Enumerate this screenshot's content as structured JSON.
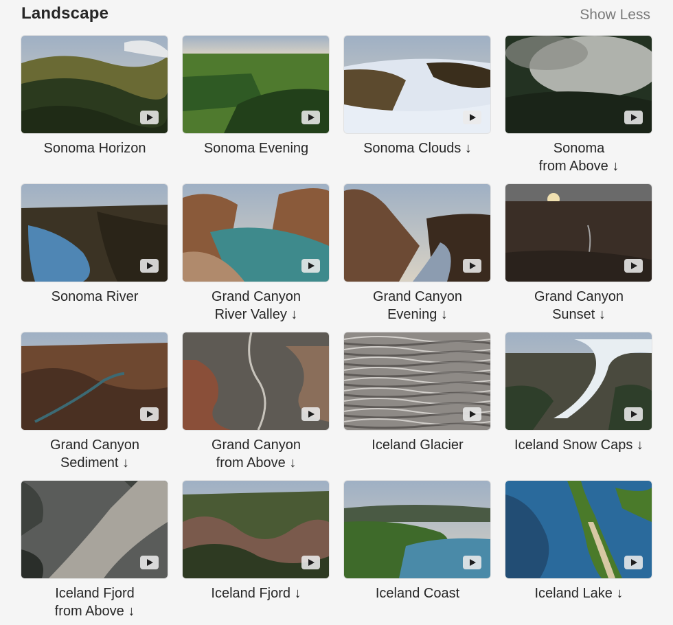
{
  "section": {
    "title": "Landscape",
    "toggle_label": "Show Less"
  },
  "tiles": [
    {
      "line1": "Sonoma Horizon",
      "line2": "",
      "scene": "hills",
      "colors": [
        "#9fb0c4",
        "#d9d2c4",
        "#2b3a1e",
        "#6a6a34",
        "#1f2b16"
      ]
    },
    {
      "line1": "Sonoma Evening",
      "line2": "",
      "scene": "fields",
      "colors": [
        "#9aa5b4",
        "#e5c9a0",
        "#2f5a24",
        "#4f7a2e",
        "#22401a"
      ]
    },
    {
      "line1": "Sonoma Clouds ↓",
      "line2": "",
      "scene": "fog",
      "colors": [
        "#7fa0c8",
        "#e8d8c0",
        "#5c4a2e",
        "#dfe6f0",
        "#3a2e1c"
      ]
    },
    {
      "line1": "Sonoma",
      "line2": "from Above ↓",
      "scene": "forest",
      "colors": [
        "#8a8c86",
        "#c8c9c4",
        "#233222",
        "#3d4a32",
        "#1a2418"
      ]
    },
    {
      "line1": "Sonoma River",
      "line2": "",
      "scene": "river",
      "colors": [
        "#b8c4cc",
        "#e8dcc4",
        "#3b3324",
        "#4f86b4",
        "#2a2418"
      ]
    },
    {
      "line1": "Grand Canyon",
      "line2": "River Valley ↓",
      "scene": "canyon-river",
      "colors": [
        "#c8d4e0",
        "#e6e6e6",
        "#8a5a3a",
        "#3e8a8c",
        "#b08a6c"
      ]
    },
    {
      "line1": "Grand Canyon",
      "line2": "Evening ↓",
      "scene": "canyon-evening",
      "colors": [
        "#5a84bc",
        "#a8c4e0",
        "#6c4a34",
        "#8c9cb0",
        "#3a2a1e"
      ]
    },
    {
      "line1": "Grand Canyon",
      "line2": "Sunset ↓",
      "scene": "sunset",
      "colors": [
        "#6a6a6a",
        "#f0e0b0",
        "#3a2e26",
        "#a4a4a4",
        "#2a221c"
      ]
    },
    {
      "line1": "Grand Canyon",
      "line2": "Sediment ↓",
      "scene": "canyon-sediment",
      "colors": [
        "#9cb0c8",
        "#d8c4a4",
        "#6e4830",
        "#3c6a74",
        "#4a3022"
      ]
    },
    {
      "line1": "Grand Canyon",
      "line2": "from Above ↓",
      "scene": "aerial",
      "colors": [
        "#5e5a54",
        "#8a6e5a",
        "#9c4a2e",
        "#c8c4bc",
        "#3c3834"
      ]
    },
    {
      "line1": "Iceland Glacier",
      "line2": "",
      "scene": "glacier",
      "colors": [
        "#8e8a86",
        "#c4beb8",
        "#5e5854",
        "#e4e0dc",
        "#3e3a38"
      ]
    },
    {
      "line1": "Iceland Snow Caps ↓",
      "line2": "",
      "scene": "snowcaps",
      "colors": [
        "#d8e4ec",
        "#f0f2f4",
        "#4a4a3e",
        "#e8eef2",
        "#2e3e2a"
      ]
    },
    {
      "line1": "Iceland Fjord",
      "line2": "from Above ↓",
      "scene": "fjord-above",
      "colors": [
        "#5a5c5a",
        "#a8a49c",
        "#3e423e",
        "#b0aca4",
        "#2a2e2a"
      ]
    },
    {
      "line1": "Iceland Fjord ↓",
      "line2": "",
      "scene": "mountains",
      "colors": [
        "#c4d0dc",
        "#e8ecee",
        "#4a5a34",
        "#7a5a4c",
        "#2e3a22"
      ]
    },
    {
      "line1": "Iceland Coast",
      "line2": "",
      "scene": "coast",
      "colors": [
        "#9cc0dc",
        "#d4e4ee",
        "#3e6a2a",
        "#4a8aa8",
        "#2a4a1c"
      ]
    },
    {
      "line1": "Iceland Lake ↓",
      "line2": "",
      "scene": "lake",
      "colors": [
        "#2a6a9c",
        "#5a9cc4",
        "#4a7a2a",
        "#d8c8a4",
        "#1e3a5a"
      ]
    }
  ]
}
